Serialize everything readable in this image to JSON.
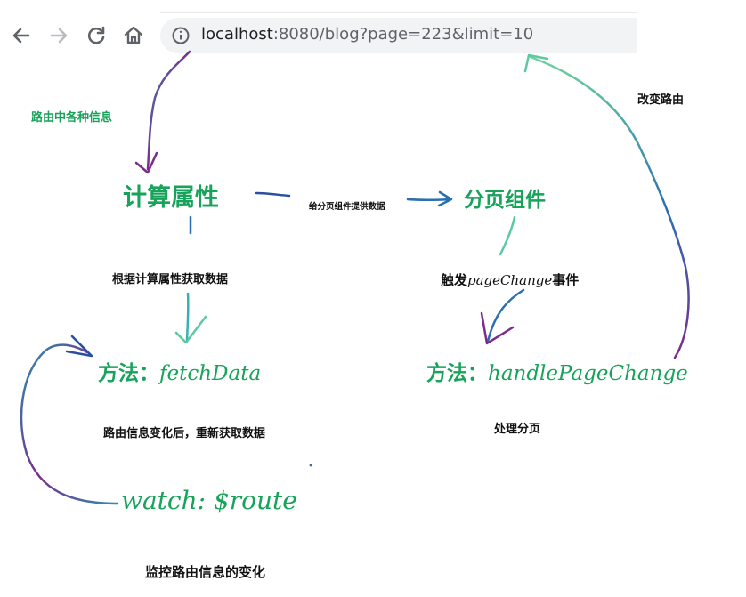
{
  "browser": {
    "url_host": "localhost",
    "url_rest": ":8080/blog?page=223&limit=10",
    "icons": [
      "back-arrow-icon",
      "forward-arrow-icon",
      "reload-icon",
      "home-icon",
      "info-icon"
    ]
  },
  "diagram": {
    "label_route_info": "路由中各种信息",
    "node_computed": "计算属性",
    "label_provide_data": "给分页组件提供数据",
    "node_pagination": "分页组件",
    "label_change_route": "改变路由",
    "label_fetch_by_computed": "根据计算属性获取数据",
    "label_trigger": "触发",
    "label_trigger_event": "pageChange",
    "label_trigger_suffix": "事件",
    "node_method_prefix_1": "方法：",
    "node_method_name_1": "fetchData",
    "node_method_prefix_2": "方法：",
    "node_method_name_2": "handlePageChange",
    "label_refetch": "路由信息变化后，重新获取数据",
    "label_handle_paging": "处理分页",
    "node_watch": "watch: $route",
    "label_watch_route": "监控路由信息的变化"
  },
  "colors": {
    "accent_green": "#17a35a",
    "arrow_purple": "#7b2d8e",
    "arrow_teal": "#2a8fb0"
  }
}
